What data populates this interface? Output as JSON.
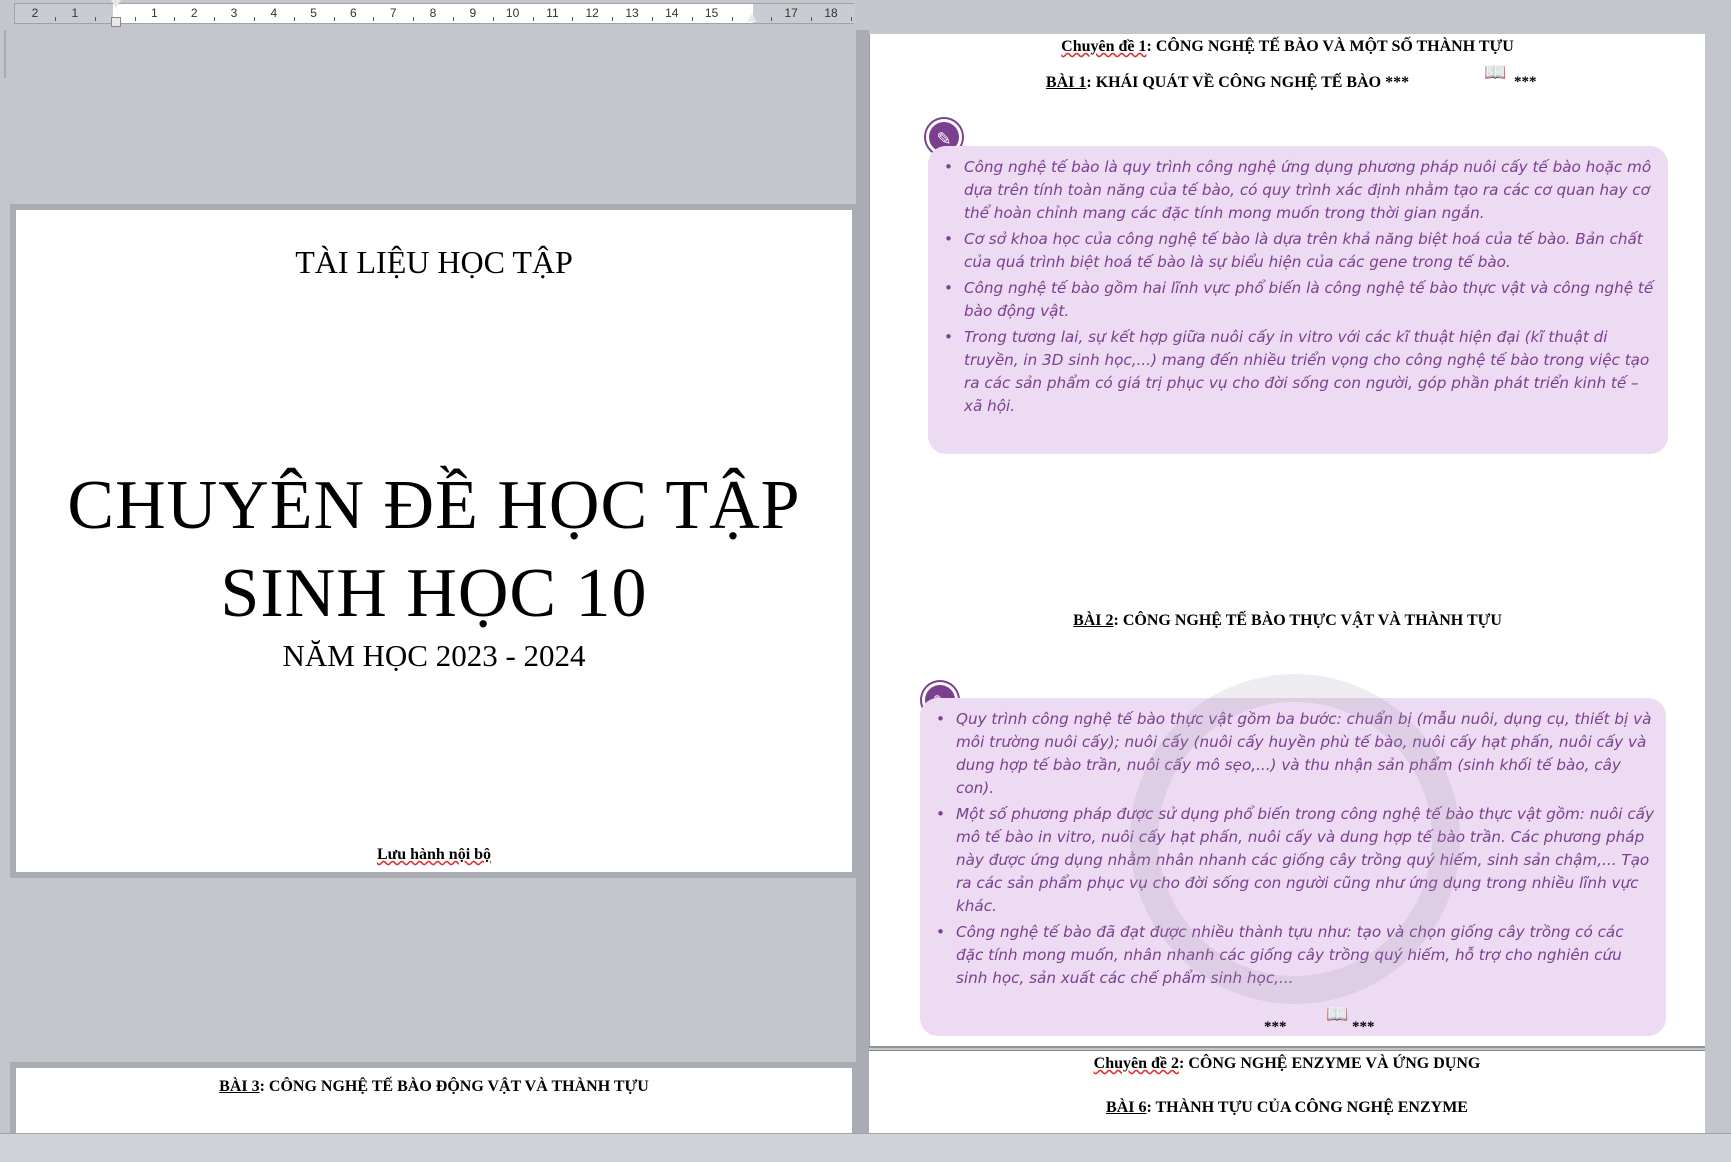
{
  "ruler": {
    "numbers": [
      "2",
      "1",
      "",
      "1",
      "2",
      "3",
      "4",
      "5",
      "6",
      "7",
      "8",
      "9",
      "10",
      "11",
      "12",
      "13",
      "14",
      "15",
      "",
      "17",
      "18"
    ]
  },
  "cover": {
    "top_label": "TÀI LIỆU HỌC TẬP",
    "title_line1": "CHUYÊN ĐỀ HỌC TẬP",
    "title_line2": "SINH HỌC 10",
    "year": "NĂM HỌC 2023 - 2024",
    "footer": "Lưu hành nội bộ"
  },
  "page3": {
    "heading_prefix": "BÀI 3",
    "heading_rest": ": CÔNG NGHỆ TẾ BÀO ĐỘNG VẬT VÀ THÀNH TỰU"
  },
  "right_page": {
    "topic1_prefix": "Chuyên đề 1",
    "topic1_rest": ": CÔNG NGHỆ TẾ BÀO VÀ MỘT SỐ THÀNH TỰU",
    "lesson1_prefix": "BÀI 1",
    "lesson1_rest": ": KHÁI QUÁT VỀ CÔNG NGHỆ TẾ BÀO ***",
    "lesson1_stars": "***",
    "box1": [
      "Công nghệ tế bào là quy trình công nghệ ứng dụng phương pháp nuôi cấy tế bào hoặc mô dựa trên tính toàn năng của tế bào, có quy trình xác định nhằm tạo ra các cơ quan hay cơ thể hoàn chỉnh mang các đặc tính mong muốn trong thời gian ngắn.",
      "Cơ sở khoa học của công nghệ tế bào là dựa trên khả năng biệt hoá của tế bào. Bản chất của quá trình biệt hoá tế bào là sự biểu hiện của các gene trong tế bào.",
      "Công nghệ tế bào gồm hai lĩnh vực phổ biến là công nghệ tế bào thực vật và công nghệ tế bào động vật.",
      "Trong tương lai, sự kết hợp giữa nuôi cấy in vitro với các kĩ thuật hiện đại (kĩ thuật di truyền, in 3D sinh học,...) mang đến nhiều triển vọng cho công nghệ tế bào trong việc tạo ra các sản phẩm có giá trị phục vụ cho đời sống con người, góp phần phát triển kinh tế – xã hội."
    ],
    "lesson2_prefix": "BÀI 2",
    "lesson2_rest": ": CÔNG NGHỆ TẾ BÀO THỰC VẬT VÀ THÀNH TỰU",
    "box2": [
      "Quy trình công nghệ tế bào thực vật gồm ba bước: chuẩn bị (mẫu nuôi, dụng cụ, thiết bị và môi trường nuôi cấy); nuôi cấy (nuôi cấy huyền phù tế bào, nuôi cấy hạt phấn, nuôi cấy và dung hợp tế bào trần, nuôi cấy mô sẹo,...) và thu nhận sản phẩm (sinh khối tế bào, cây con).",
      "Một số phương pháp được sử dụng phổ biến trong công nghệ tế bào thực vật gồm: nuôi cấy mô tế bào in vitro, nuôi cấy hạt phấn, nuôi cấy và dung hợp tế bào trần. Các phương pháp này được ứng dụng nhằm nhân nhanh các giống cây trồng quý hiếm, sinh sản chậm,... Tạo ra các sản phẩm phục vụ cho đời sống con người cũng như ứng dụng trong nhiều lĩnh vực khác.",
      "Công nghệ tế bào đã đạt được nhiều thành tựu như: tạo và chọn giống cây trồng có các đặc tính mong muốn, nhân nhanh các giống cây trồng quý hiếm, hỗ trợ cho nghiên cứu sinh học, sản xuất các chế phẩm sinh học,..."
    ],
    "stars_left": "***",
    "stars_right": "***",
    "topic2_prefix": "Chuyên đề 2",
    "topic2_rest": ": CÔNG NGHỆ ENZYME VÀ ỨNG DỤNG",
    "lesson6_prefix": "BÀI 6",
    "lesson6_rest": ": THÀNH TỰU CỦA CÔNG NGHỆ ENZYME"
  },
  "icons": {
    "book": "open-book-icon",
    "pin": "lesson-summary-pin-icon"
  },
  "colors": {
    "box_bg": "#ecdbf2",
    "box_text": "#7a3f8f",
    "app_bg": "#c3c6cb"
  }
}
